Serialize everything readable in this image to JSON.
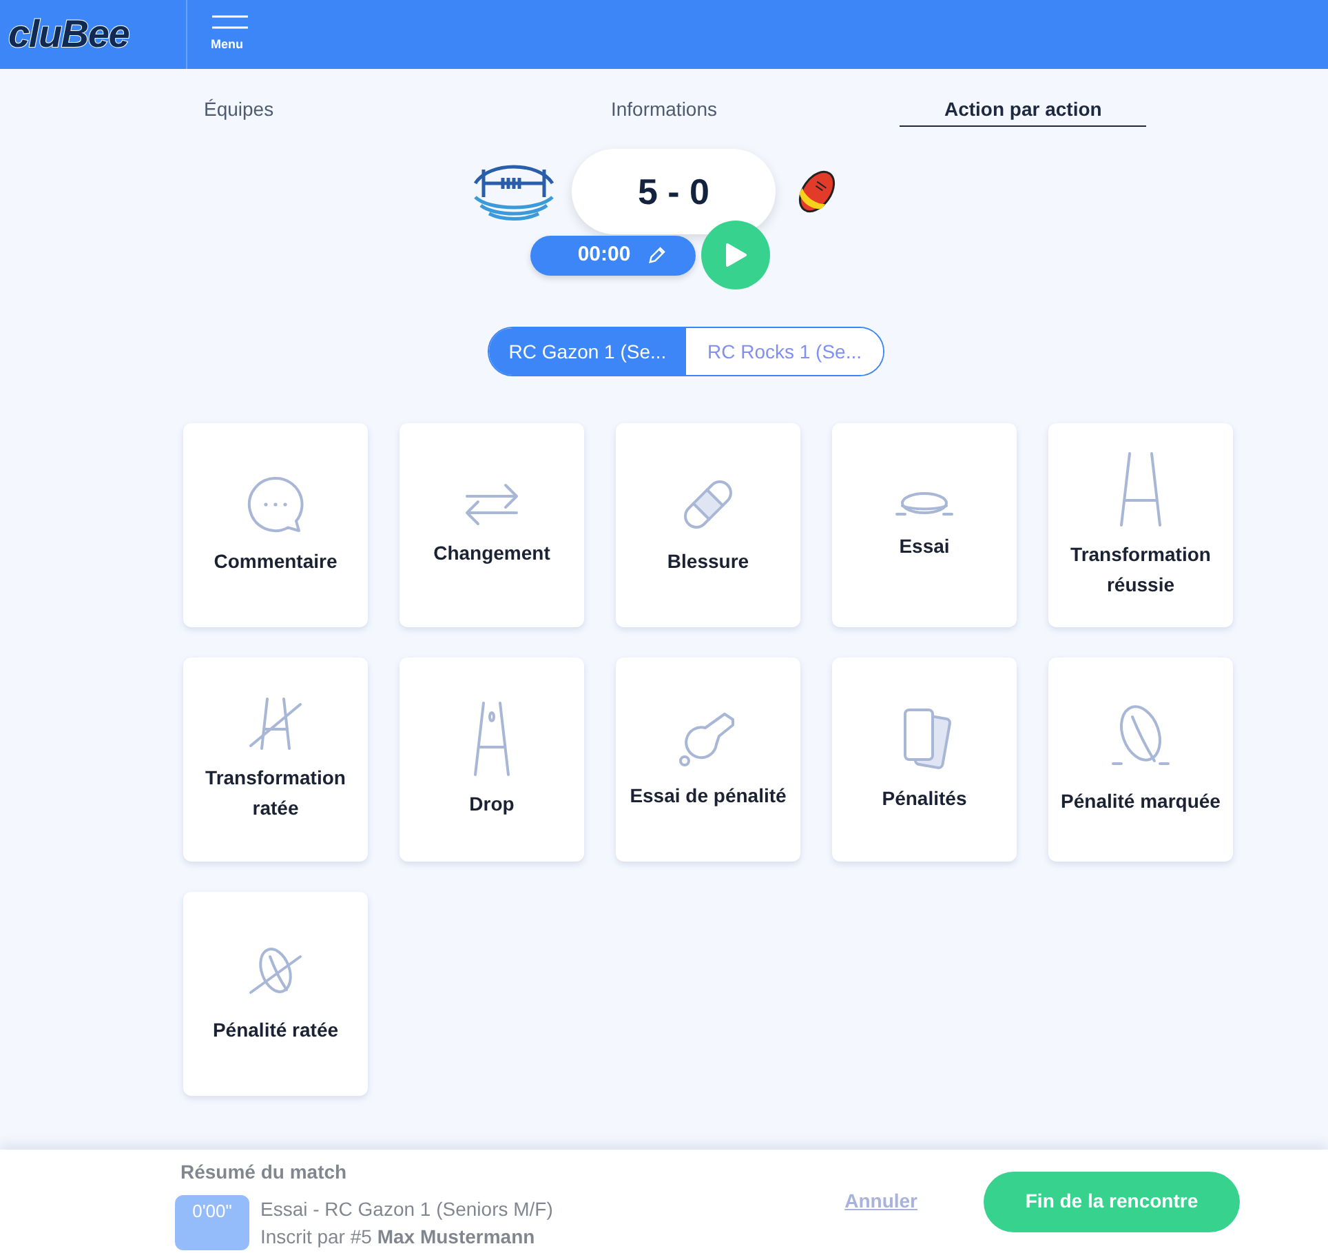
{
  "header": {
    "logo": "cluBee",
    "menu_label": "Menu"
  },
  "tabs": [
    {
      "label": "Équipes",
      "selected": false
    },
    {
      "label": "Informations",
      "selected": false
    },
    {
      "label": "Action par action",
      "selected": true
    }
  ],
  "score": "5 - 0",
  "timer": "00:00",
  "teams": [
    {
      "label": "RC Gazon 1 (Se...",
      "selected": true
    },
    {
      "label": "RC Rocks 1 (Se...",
      "selected": false
    }
  ],
  "actions": [
    {
      "label": "Commentaire",
      "kind": "comment"
    },
    {
      "label": "Changement",
      "kind": "swap"
    },
    {
      "label": "Blessure",
      "kind": "bandage"
    },
    {
      "label": "Essai",
      "kind": "try"
    },
    {
      "label": "Transformation réussie",
      "kind": "goal"
    },
    {
      "label": "Transformation ratée",
      "kind": "goal-missed"
    },
    {
      "label": "Drop",
      "kind": "drop"
    },
    {
      "label": "Essai de pénalité",
      "kind": "whistle"
    },
    {
      "label": "Pénalités",
      "kind": "cards"
    },
    {
      "label": "Pénalité marquée",
      "kind": "kick"
    },
    {
      "label": "Pénalité ratée",
      "kind": "kick-missed"
    }
  ],
  "summary": {
    "title": "Résumé du match",
    "time": "0'00\"",
    "event": "Essai - RC Gazon 1 (Seniors M/F)",
    "author_prefix": "Inscrit par #5",
    "author": "Max Mustermann"
  },
  "footer": {
    "cancel": "Annuler",
    "finish": "Fin de la rencontre"
  }
}
